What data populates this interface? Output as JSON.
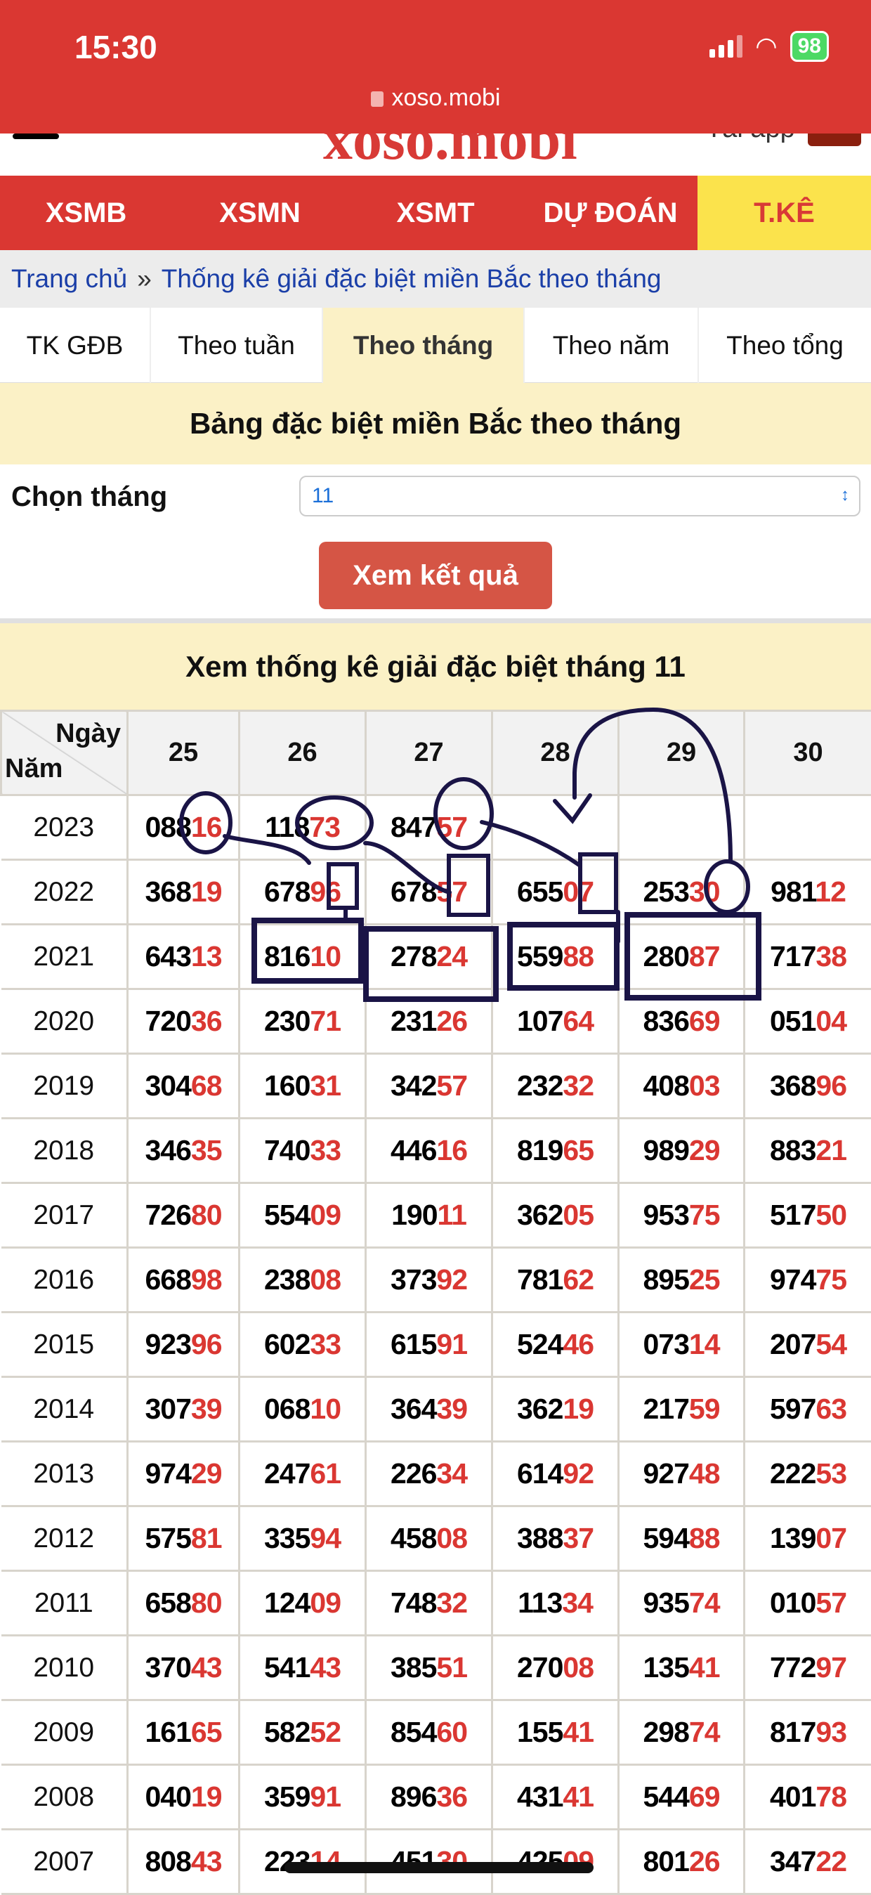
{
  "status": {
    "time": "15:30",
    "battery": "98"
  },
  "browser": {
    "url": "xoso.mobi"
  },
  "header": {
    "logo": "xoso.mobi",
    "app_text": "Tải app"
  },
  "nav": [
    {
      "label": "XSMB"
    },
    {
      "label": "XSMN"
    },
    {
      "label": "XSMT"
    },
    {
      "label": "DỰ ĐOÁN"
    },
    {
      "label": "T.KÊ",
      "active": true
    }
  ],
  "breadcrumb": {
    "home": "Trang chủ",
    "sep": "»",
    "current": "Thống kê giải đặc biệt miền Bắc theo tháng"
  },
  "tabs": [
    {
      "label": "TK GĐB"
    },
    {
      "label": "Theo tuần"
    },
    {
      "label": "Theo tháng",
      "active": true
    },
    {
      "label": "Theo năm"
    },
    {
      "label": "Theo tổng"
    }
  ],
  "form": {
    "title": "Bảng đặc biệt miền Bắc theo tháng",
    "label": "Chọn tháng",
    "month": "11",
    "submit": "Xem kết quả"
  },
  "results": {
    "title": "Xem thống kê giải đặc biệt tháng 11",
    "corner_day": "Ngày",
    "corner_year": "Năm",
    "days": [
      "25",
      "26",
      "27",
      "28",
      "29",
      "30"
    ],
    "rows": [
      {
        "year": "2023",
        "values": [
          "08816",
          "11873",
          "84757",
          "",
          "",
          ""
        ]
      },
      {
        "year": "2022",
        "values": [
          "36819",
          "67896",
          "67857",
          "65507",
          "25330",
          "98112"
        ]
      },
      {
        "year": "2021",
        "values": [
          "64313",
          "81610",
          "27824",
          "55988",
          "28087",
          "71738"
        ]
      },
      {
        "year": "2020",
        "values": [
          "72036",
          "23071",
          "23126",
          "10764",
          "83669",
          "05104"
        ]
      },
      {
        "year": "2019",
        "values": [
          "30468",
          "16031",
          "34257",
          "23232",
          "40803",
          "36896"
        ]
      },
      {
        "year": "2018",
        "values": [
          "34635",
          "74033",
          "44616",
          "81965",
          "98929",
          "88321"
        ]
      },
      {
        "year": "2017",
        "values": [
          "72680",
          "55409",
          "19011",
          "36205",
          "95375",
          "51750"
        ]
      },
      {
        "year": "2016",
        "values": [
          "66898",
          "23808",
          "37392",
          "78162",
          "89525",
          "97475"
        ]
      },
      {
        "year": "2015",
        "values": [
          "92396",
          "60233",
          "61591",
          "52446",
          "07314",
          "20754"
        ]
      },
      {
        "year": "2014",
        "values": [
          "30739",
          "06810",
          "36439",
          "36219",
          "21759",
          "59763"
        ]
      },
      {
        "year": "2013",
        "values": [
          "97429",
          "24761",
          "22634",
          "61492",
          "92748",
          "22253"
        ]
      },
      {
        "year": "2012",
        "values": [
          "57581",
          "33594",
          "45808",
          "38837",
          "59488",
          "13907"
        ]
      },
      {
        "year": "2011",
        "values": [
          "65880",
          "12409",
          "74832",
          "11334",
          "93574",
          "01057"
        ]
      },
      {
        "year": "2010",
        "values": [
          "37043",
          "54143",
          "38551",
          "27008",
          "13541",
          "77297"
        ]
      },
      {
        "year": "2009",
        "values": [
          "16165",
          "58252",
          "85460",
          "15541",
          "29874",
          "81793"
        ]
      },
      {
        "year": "2008",
        "values": [
          "04019",
          "35991",
          "89636",
          "43141",
          "54469",
          "40178"
        ]
      },
      {
        "year": "2007",
        "values": [
          "80843",
          "22314",
          "45130",
          "42509",
          "80126",
          "34722"
        ]
      }
    ]
  },
  "colors": {
    "brand_red": "#da3732",
    "active_yellow": "#fbe34c",
    "band_yellow": "#fbf1c6",
    "highlight_digits": "#da3732",
    "annotation_ink": "#1a1446"
  }
}
